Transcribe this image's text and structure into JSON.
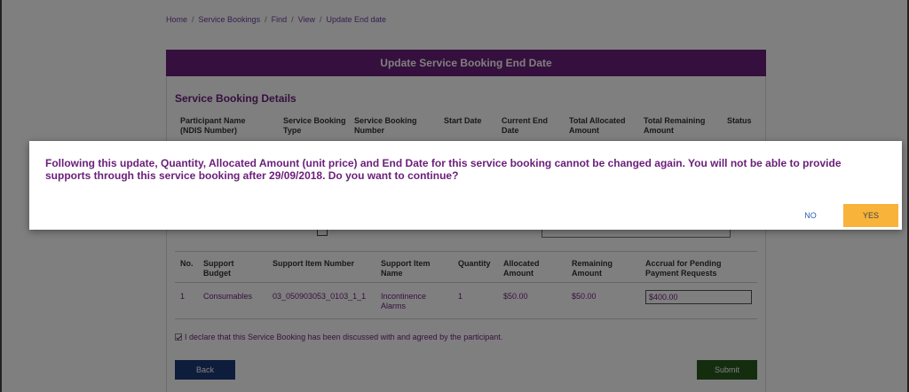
{
  "breadcrumb": [
    "Home",
    "Service Bookings",
    "Find",
    "View",
    "Update End date"
  ],
  "panel": {
    "title": "Update Service Booking End Date",
    "section_title": "Service Booking Details"
  },
  "details_headers": [
    "Participant Name (NDIS Number)",
    "Service Booking Type",
    "Service Booking Number",
    "Start Date",
    "Current End Date",
    "Total Allocated Amount",
    "Total Remaining Amount",
    "Status"
  ],
  "items_table": {
    "headers": [
      "No.",
      "Support Budget",
      "Support Item Number",
      "Support Item Name",
      "Quantity",
      "Allocated Amount",
      "Remaining Amount",
      "Accrual for Pending Payment Requests"
    ],
    "rows": [
      {
        "no": "1",
        "budget": "Consumables",
        "item_number": "03_050903053_0103_1_1",
        "item_name": "Incontinence Alarms",
        "quantity": "1",
        "allocated": "$50.00",
        "remaining": "$50.00",
        "accrual": "$400.00"
      }
    ]
  },
  "declaration": "I declare that this Service Booking has been discussed with and agreed by the participant.",
  "buttons": {
    "back": "Back",
    "submit": "Submit"
  },
  "modal": {
    "message": "Following this update, Quantity, Allocated Amount (unit price) and End Date for this service booking cannot be changed again. You will not be able to provide supports through this service booking after 29/09/2018. Do you want to continue?",
    "no_label": "NO",
    "yes_label": "YES"
  },
  "colors": {
    "brand_purple": "#6b1e7a",
    "back_blue": "#1f3a78",
    "submit_green": "#285a1e",
    "yes_amber": "#f7b33a"
  }
}
